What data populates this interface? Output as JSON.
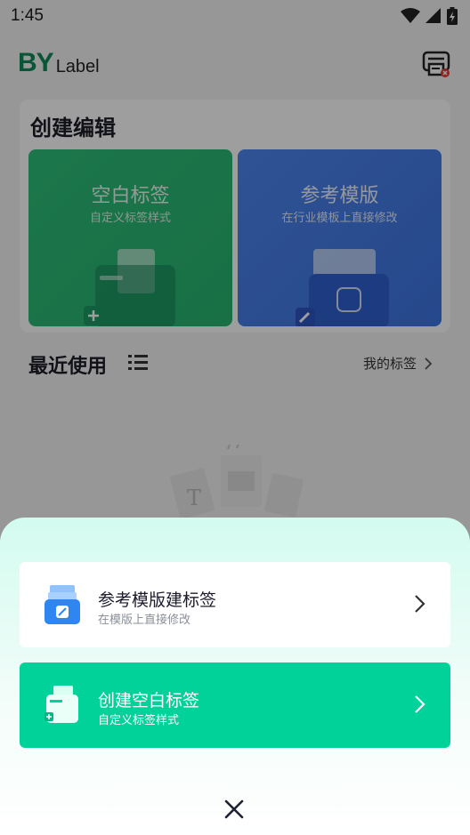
{
  "status_bar": {
    "time": "1:45"
  },
  "header": {
    "logo_by": "BY",
    "logo_label": "Label"
  },
  "create": {
    "title": "创建编辑",
    "blank_tile": {
      "title": "空白标签",
      "subtitle": "自定义标签样式"
    },
    "template_tile": {
      "title": "参考模版",
      "subtitle": "在行业模板上直接修改"
    }
  },
  "recent": {
    "title": "最近使用",
    "my_labels": "我的标签"
  },
  "sheet": {
    "options": [
      {
        "title": "参考模版建标签",
        "subtitle": "在模版上直接修改"
      },
      {
        "title": "创建空白标签",
        "subtitle": "自定义标签样式"
      }
    ]
  },
  "colors": {
    "brand_green": "#0e8a5a",
    "accent": "#00d29a",
    "tile_green": "#2fbf7a",
    "tile_blue": "#4d86ef"
  },
  "icons": [
    "wifi-icon",
    "signal-icon",
    "battery-icon",
    "printer-icon",
    "list-icon",
    "chevron-right-icon",
    "close-icon",
    "folder-icon",
    "card-box-icon"
  ]
}
